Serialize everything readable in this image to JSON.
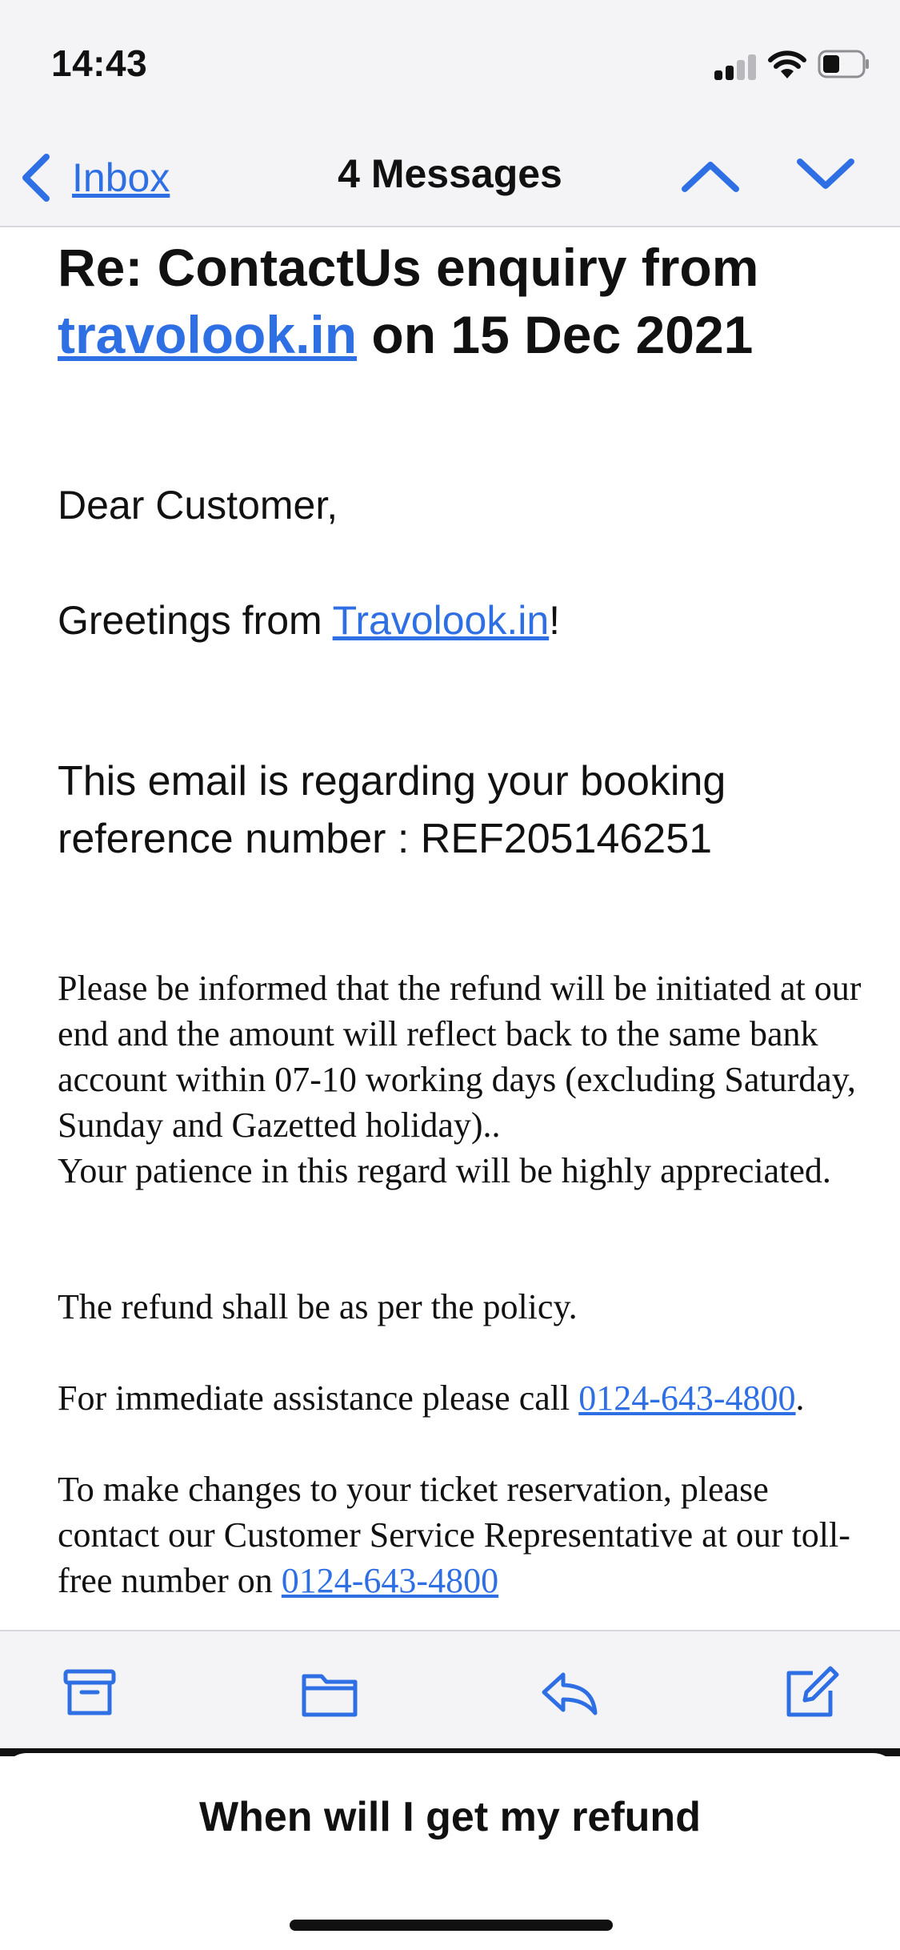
{
  "status_bar": {
    "time": "14:43"
  },
  "nav": {
    "back_label": "Inbox",
    "title": "4 Messages"
  },
  "email": {
    "subject_line1": "Re: ContactUs enquiry from",
    "subject_link": "travolook.in",
    "subject_rest": " on 15 Dec 2021",
    "salutation": "Dear Customer,",
    "greeting_prefix": "Greetings from ",
    "greeting_link": "Travolook.in",
    "greeting_suffix": "!",
    "reference_line1": "This email is regarding your booking",
    "reference_line2": "reference number : REF205146251",
    "para_refund": "Please be informed that the refund will be initiated at our end and the amount will reflect back to the same bank account within 07-10 working days (excluding Saturday, Sunday and Gazetted holiday)..",
    "para_patience": "Your patience in this regard will be highly appreciated.",
    "para_policy": "The refund shall be as per the policy.",
    "assist_prefix": "For immediate assistance please call ",
    "assist_phone": "0124-643-4800",
    "assist_suffix": ".",
    "changes_text": "To make changes to your ticket reservation, please contact our Customer Service Representative at our toll-free number on ",
    "changes_phone": "0124-643-4800"
  },
  "toolbar": {
    "icons": [
      "archive-icon",
      "folder-icon",
      "reply-icon",
      "compose-icon"
    ]
  },
  "sheet": {
    "title": "When will I get my refund"
  },
  "colors": {
    "accent": "#2f6fe4",
    "bar_background": "#f4f4f6",
    "text": "#111111"
  }
}
